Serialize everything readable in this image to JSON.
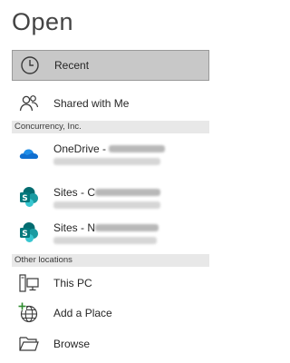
{
  "title": "Open",
  "recent": {
    "label": "Recent",
    "icon": "clock-icon"
  },
  "shared": {
    "label": "Shared with Me",
    "icon": "people-icon"
  },
  "org_section": "Concurrency, Inc.",
  "locations": [
    {
      "label": "OneDrive - ",
      "icon": "onedrive-cloud-icon"
    },
    {
      "label": "Sites - C",
      "icon": "sharepoint-icon"
    },
    {
      "label": "Sites - N",
      "icon": "sharepoint-icon"
    }
  ],
  "other_section": "Other locations",
  "others": [
    {
      "label": "This PC",
      "icon": "computer-icon"
    },
    {
      "label": "Add a Place",
      "icon": "globe-add-icon"
    },
    {
      "label": "Browse",
      "icon": "folder-icon"
    }
  ],
  "colors": {
    "selected_bg": "#c8c8c8",
    "section_bg": "#e8e8e8",
    "onedrive_blue": "#0f6fd0",
    "sharepoint_teal": "#038387"
  }
}
